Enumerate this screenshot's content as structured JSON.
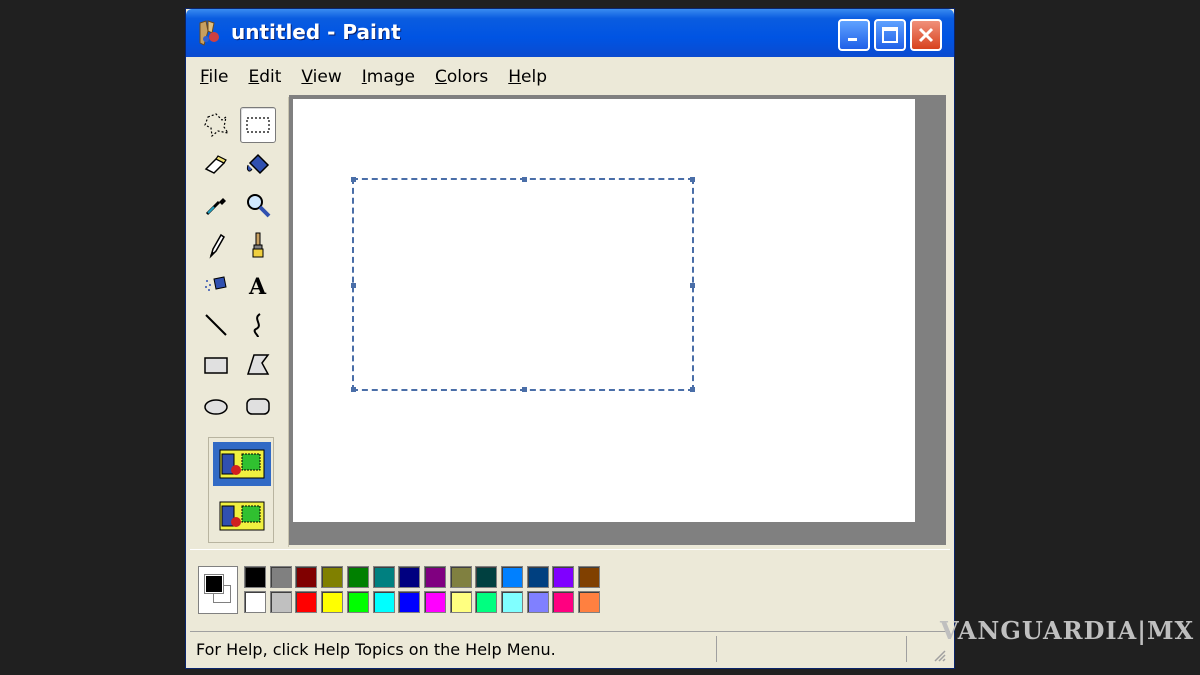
{
  "window": {
    "title": "untitled - Paint",
    "controls": {
      "minimize": "_",
      "maximize": "□",
      "close": "✕"
    }
  },
  "menu": [
    {
      "key": "F",
      "rest": "ile"
    },
    {
      "key": "E",
      "rest": "dit"
    },
    {
      "key": "V",
      "rest": "iew"
    },
    {
      "key": "I",
      "rest": "mage"
    },
    {
      "key": "C",
      "rest": "olors"
    },
    {
      "key": "H",
      "rest": "elp"
    }
  ],
  "tools": [
    "free-form-select-icon",
    "rect-select-icon",
    "eraser-icon",
    "fill-bucket-icon",
    "eyedropper-icon",
    "magnifier-icon",
    "pencil-icon",
    "brush-icon",
    "airbrush-icon",
    "text-icon",
    "line-icon",
    "curve-icon",
    "rectangle-icon",
    "polygon-icon",
    "ellipse-icon",
    "rounded-rectangle-icon"
  ],
  "active_tool": "rect-select-icon",
  "text_tool_glyph": "A",
  "palette": {
    "foreground": "#000000",
    "background": "#ffffff",
    "top_row": [
      "#000000",
      "#808080",
      "#800000",
      "#808000",
      "#008000",
      "#008080",
      "#000080",
      "#800080",
      "#808040",
      "#004040",
      "#0080ff",
      "#004080",
      "#8000ff",
      "#804000"
    ],
    "bottom_row": [
      "#ffffff",
      "#c0c0c0",
      "#ff0000",
      "#ffff00",
      "#00ff00",
      "#00ffff",
      "#0000ff",
      "#ff00ff",
      "#ffff80",
      "#00ff80",
      "#80ffff",
      "#8080ff",
      "#ff0080",
      "#ff8040"
    ]
  },
  "status": {
    "help_text": "For Help, click Help Topics on the Help Menu."
  },
  "watermark": "VANGUARDIA|MX"
}
